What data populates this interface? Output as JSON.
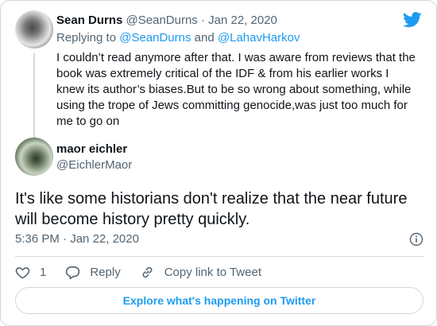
{
  "brand": {
    "logo_icon": "twitter-bird-icon",
    "accent_color": "#1d9bf0"
  },
  "parent_tweet": {
    "display_name": "Sean Durns",
    "handle": "@SeanDurns",
    "separator": " · ",
    "date": "Jan 22, 2020",
    "replying_prefix": "Replying to ",
    "replying_user_1": "@SeanDurns",
    "replying_and": " and ",
    "replying_user_2": "@LahavHarkov",
    "text": "I couldn’t read anymore after that. I was aware from reviews that the book was extremely critical of the IDF & from his earlier works I knew its author’s biases.But to be so wrong about something, while using the trope of Jews committing genocide,was just too much for me to go on"
  },
  "main_tweet": {
    "display_name": "maor eichler",
    "handle": "@EichlerMaor",
    "text": "It's like some historians don't realize that the near future will become history pretty quickly.",
    "time": "5:36 PM",
    "separator": " · ",
    "date": "Jan 22, 2020",
    "info_icon": "info-icon"
  },
  "actions": {
    "like_icon": "heart-icon",
    "like_count": "1",
    "reply_icon": "reply-bubble-icon",
    "reply_label": "Reply",
    "copy_icon": "link-icon",
    "copy_label": "Copy link to Tweet"
  },
  "explore": {
    "label": "Explore what's happening on Twitter"
  }
}
